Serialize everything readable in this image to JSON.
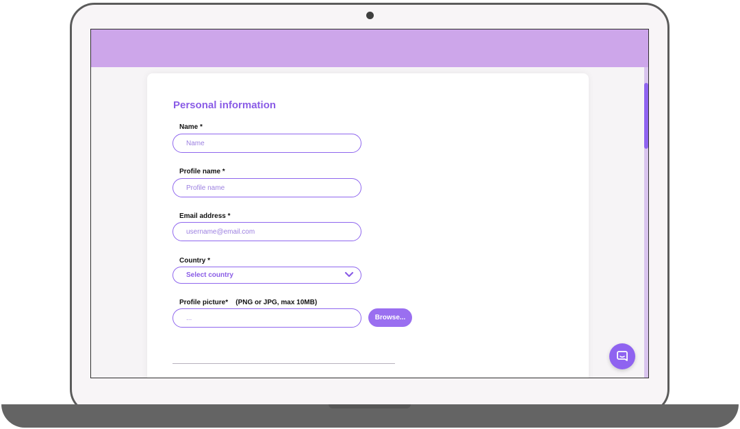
{
  "colors": {
    "header": "#cda6ea",
    "accent": "#8a5ce6",
    "button": "#9a6ff0",
    "input_border": "#8e65ee"
  },
  "form": {
    "section_title": "Personal information",
    "name": {
      "label": "Name *",
      "placeholder": "Name",
      "value": ""
    },
    "profile_name": {
      "label": "Profile name *",
      "placeholder": "Profile name",
      "value": ""
    },
    "email": {
      "label": "Email address *",
      "placeholder": "username@email.com",
      "value": ""
    },
    "country": {
      "label": "Country *",
      "selected": "Select country",
      "icon": "chevron-down-icon"
    },
    "profile_picture": {
      "label": "Profile picture*    (PNG or JPG, max 10MB)",
      "placeholder": "...",
      "browse_label": "Browse..."
    }
  },
  "chat_widget": {
    "icon": "chat-bubble-icon"
  }
}
